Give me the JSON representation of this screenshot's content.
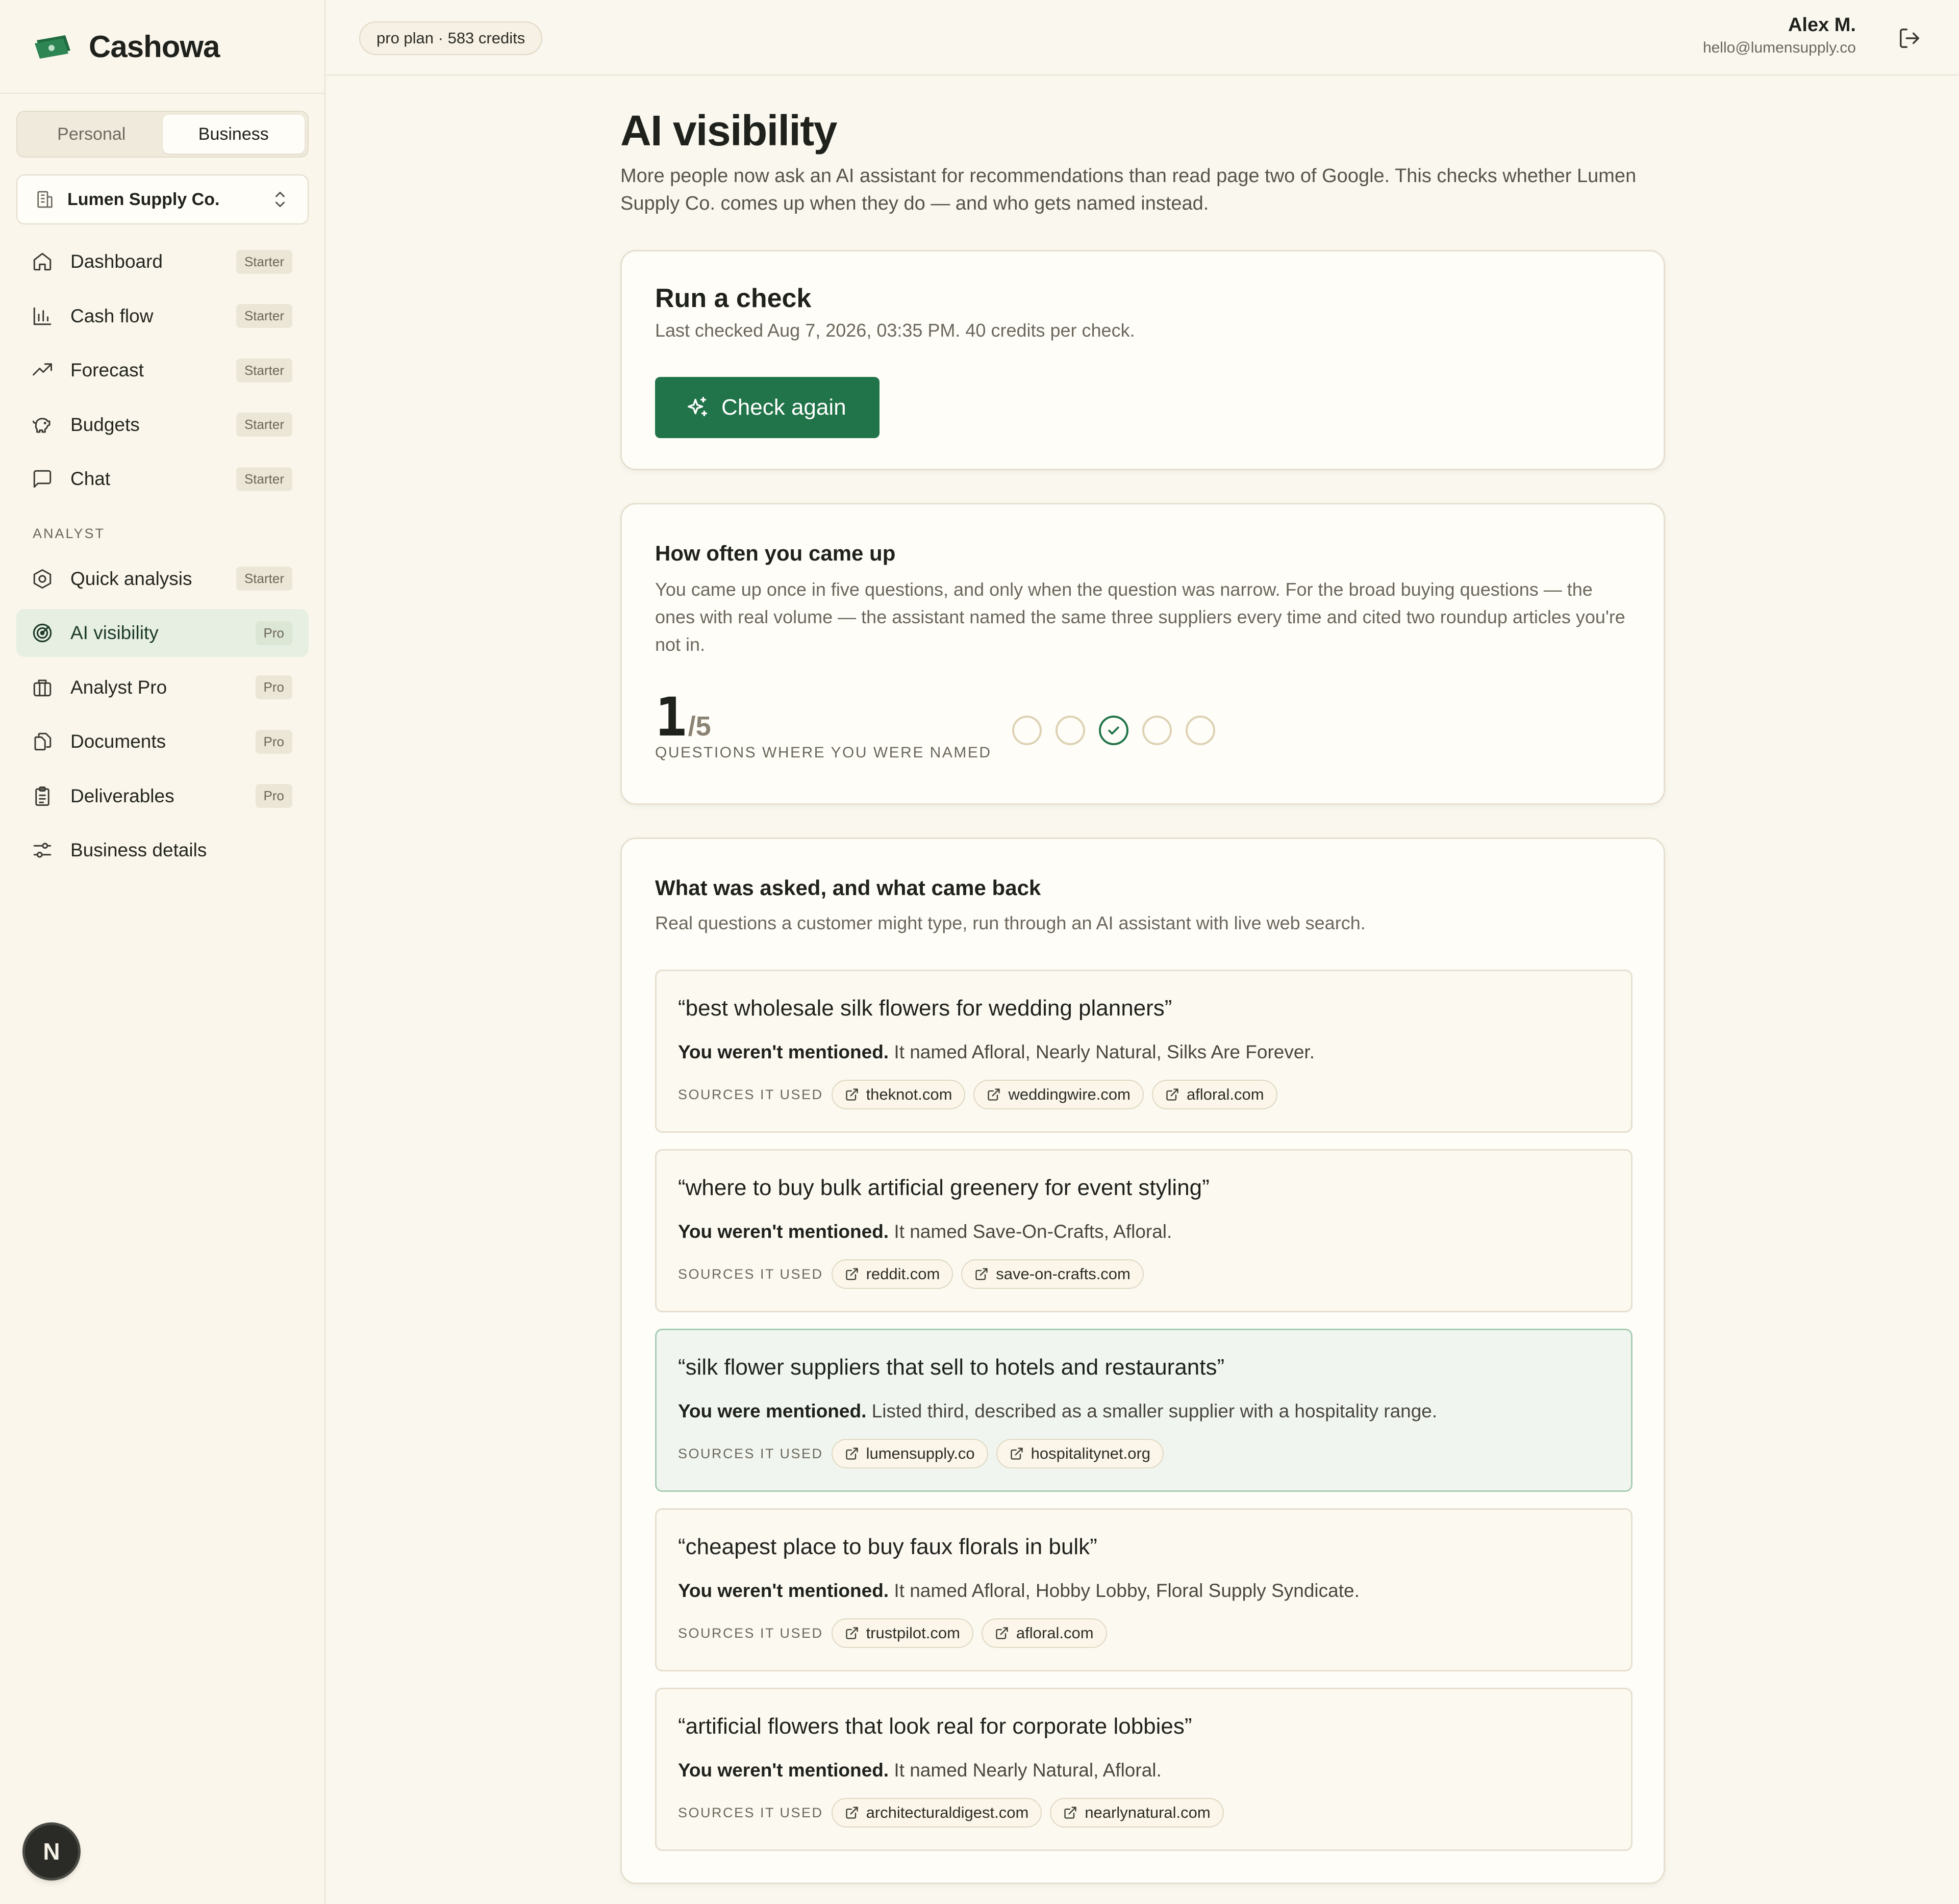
{
  "app": {
    "name": "Cashowa",
    "brand_color": "#217449"
  },
  "mode_toggle": {
    "personal": "Personal",
    "business": "Business",
    "active": "Business"
  },
  "org": {
    "name": "Lumen Supply Co."
  },
  "nav": {
    "items": [
      {
        "label": "Dashboard",
        "badge": "Starter",
        "icon": "home-icon"
      },
      {
        "label": "Cash flow",
        "badge": "Starter",
        "icon": "bar-chart-icon"
      },
      {
        "label": "Forecast",
        "badge": "Starter",
        "icon": "trending-up-icon"
      },
      {
        "label": "Budgets",
        "badge": "Starter",
        "icon": "piggy-bank-icon"
      },
      {
        "label": "Chat",
        "badge": "Starter",
        "icon": "message-square-icon"
      }
    ],
    "section_label": "ANALYST",
    "analyst_items": [
      {
        "label": "Quick analysis",
        "badge": "Starter",
        "icon": "hexagon-icon"
      },
      {
        "label": "AI visibility",
        "badge": "Pro",
        "icon": "radar-icon",
        "active": true
      },
      {
        "label": "Analyst Pro",
        "badge": "Pro",
        "icon": "briefcase-icon"
      },
      {
        "label": "Documents",
        "badge": "Pro",
        "icon": "documents-icon"
      },
      {
        "label": "Deliverables",
        "badge": "Pro",
        "icon": "clipboard-icon"
      },
      {
        "label": "Business details",
        "icon": "sliders-icon"
      }
    ]
  },
  "dev_badge": "N",
  "topbar": {
    "plan": "pro plan · 583 credits",
    "user_name": "Alex M.",
    "user_email": "hello@lumensupply.co"
  },
  "page": {
    "title": "AI visibility",
    "intro": "More people now ask an AI assistant for recommendations than read page two of Google. This checks whether Lumen Supply Co. comes up when they do — and who gets named instead."
  },
  "run_check": {
    "title": "Run a check",
    "subtitle": "Last checked Aug 7, 2026, 03:35 PM. 40 credits per check.",
    "button": "Check again"
  },
  "frequency": {
    "title": "How often you came up",
    "description": "You came up once in five questions, and only when the question was narrow. For the broad buying questions — the ones with real volume — the assistant named the same three suppliers every time and cited two roundup articles you're not in.",
    "score": "1",
    "total": "/5",
    "caption": "QUESTIONS WHERE YOU WERE NAMED",
    "results": [
      false,
      false,
      true,
      false,
      false
    ]
  },
  "questions": {
    "title": "What was asked, and what came back",
    "subtitle": "Real questions a customer might type, run through an AI assistant with live web search.",
    "sources_label": "SOURCES IT USED",
    "items": [
      {
        "question": "“best wholesale silk flowers for wedding planners”",
        "verdict": "You weren't mentioned.",
        "detail": " It named Afloral, Nearly Natural, Silks Are Forever.",
        "mentioned": false,
        "sources": [
          "theknot.com",
          "weddingwire.com",
          "afloral.com"
        ]
      },
      {
        "question": "“where to buy bulk artificial greenery for event styling”",
        "verdict": "You weren't mentioned.",
        "detail": " It named Save-On-Crafts, Afloral.",
        "mentioned": false,
        "sources": [
          "reddit.com",
          "save-on-crafts.com"
        ]
      },
      {
        "question": "“silk flower suppliers that sell to hotels and restaurants”",
        "verdict": "You were mentioned.",
        "detail": " Listed third, described as a smaller supplier with a hospitality range.",
        "mentioned": true,
        "sources": [
          "lumensupply.co",
          "hospitalitynet.org"
        ]
      },
      {
        "question": "“cheapest place to buy faux florals in bulk”",
        "verdict": "You weren't mentioned.",
        "detail": " It named Afloral, Hobby Lobby, Floral Supply Syndicate.",
        "mentioned": false,
        "sources": [
          "trustpilot.com",
          "afloral.com"
        ]
      },
      {
        "question": "“artificial flowers that look real for corporate lobbies”",
        "verdict": "You weren't mentioned.",
        "detail": " It named Nearly Natural, Afloral.",
        "mentioned": false,
        "sources": [
          "architecturaldigest.com",
          "nearlynatural.com"
        ]
      }
    ]
  }
}
